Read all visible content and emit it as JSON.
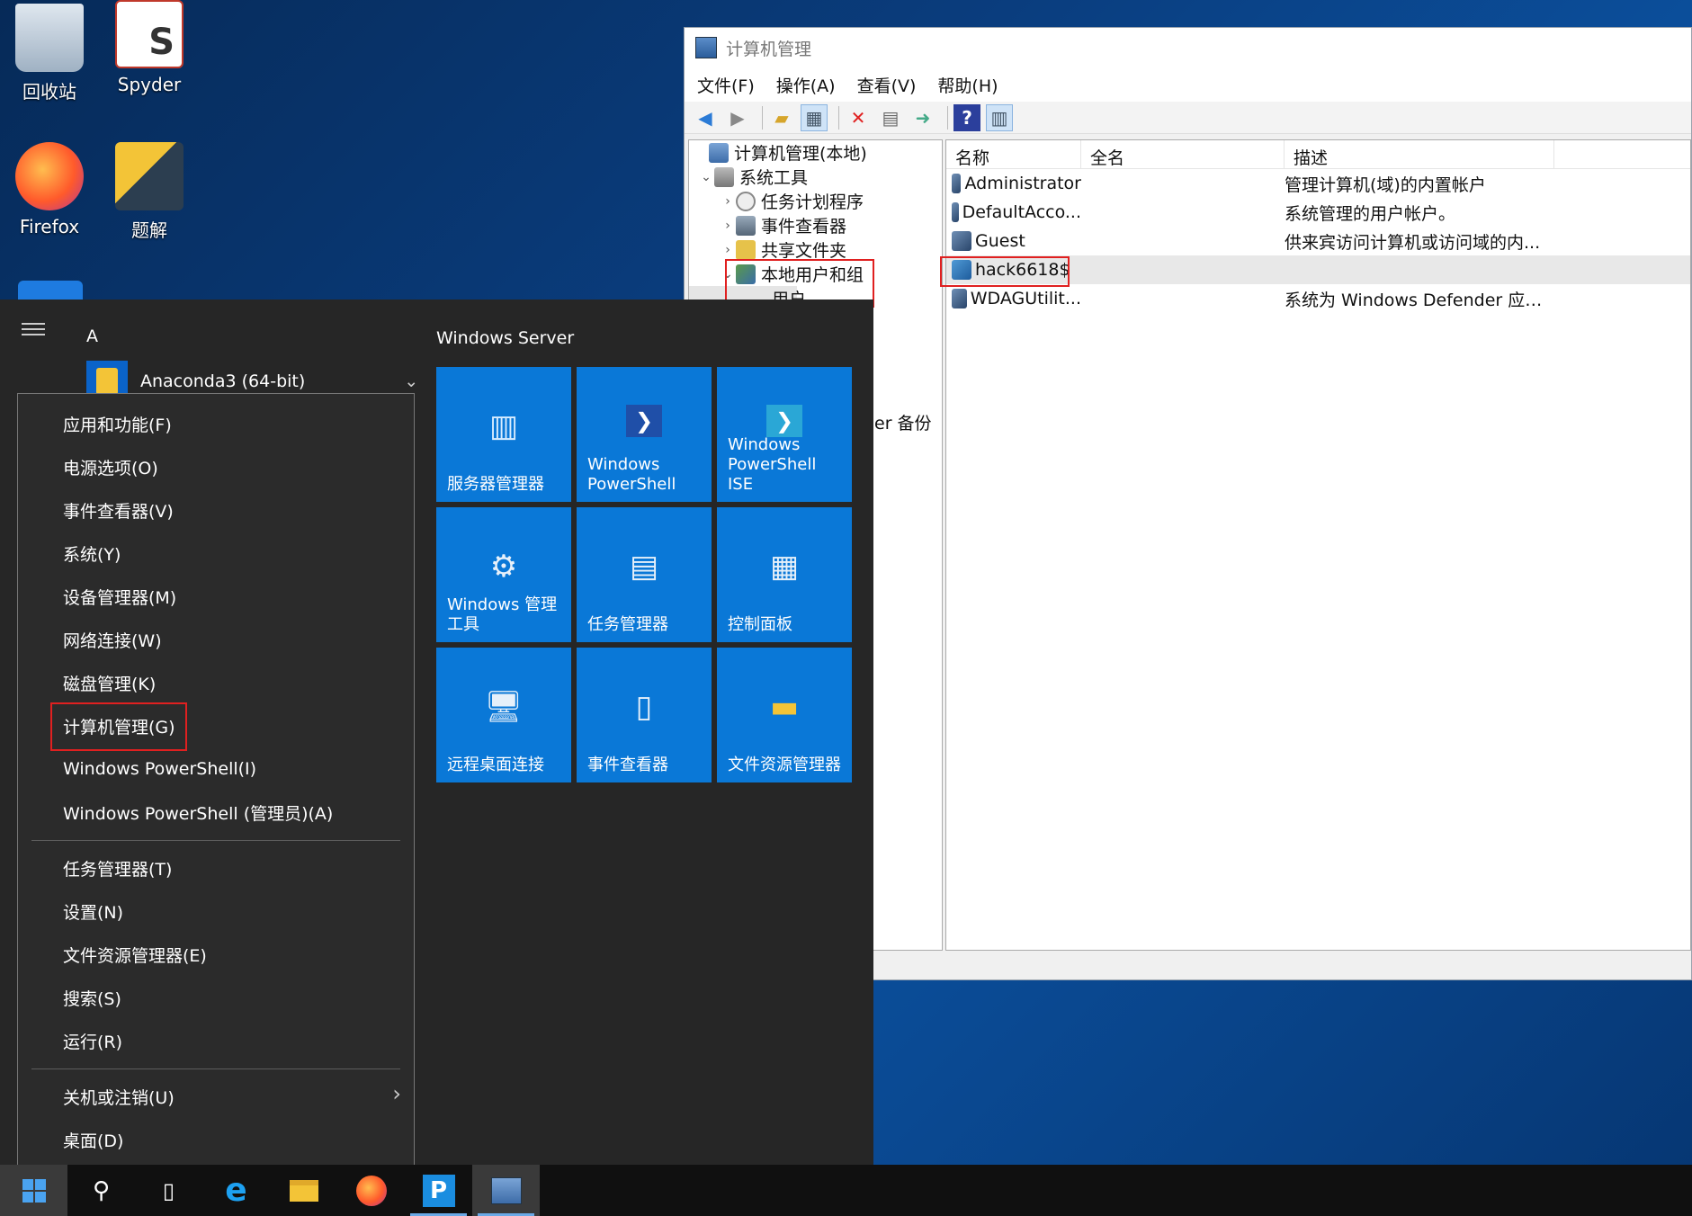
{
  "desktop": {
    "icons": [
      {
        "label": "回收站",
        "icon": "recycle-bin-icon"
      },
      {
        "label": "Spyder",
        "icon": "spyder-icon"
      },
      {
        "label": "Firefox",
        "icon": "firefox-icon"
      },
      {
        "label": "题解",
        "icon": "python-icon"
      }
    ]
  },
  "computer_management": {
    "title": "计算机管理",
    "menu": [
      "文件(F)",
      "操作(A)",
      "查看(V)",
      "帮助(H)"
    ],
    "tree": [
      {
        "label": "计算机管理(本地)",
        "level": 0,
        "arrow": ""
      },
      {
        "label": "系统工具",
        "level": 1,
        "arrow": "⌄"
      },
      {
        "label": "任务计划程序",
        "level": 2,
        "arrow": "›"
      },
      {
        "label": "事件查看器",
        "level": 2,
        "arrow": "›"
      },
      {
        "label": "共享文件夹",
        "level": 2,
        "arrow": "›"
      },
      {
        "label": "本地用户和组",
        "level": 2,
        "arrow": "⌄"
      },
      {
        "label": "用户",
        "level": 3,
        "arrow": ""
      }
    ],
    "tree_partial_text": "er 备份",
    "columns": [
      "名称",
      "全名",
      "描述"
    ],
    "users": [
      {
        "name": "Administrator",
        "full_name": "",
        "description": "管理计算机(域)的内置帐户"
      },
      {
        "name": "DefaultAcco...",
        "full_name": "",
        "description": "系统管理的用户帐户。"
      },
      {
        "name": "Guest",
        "full_name": "",
        "description": "供来宾访问计算机或访问域的内..."
      },
      {
        "name": "hack6618$",
        "full_name": "",
        "description": ""
      },
      {
        "name": "WDAGUtilit...",
        "full_name": "",
        "description": "系统为 Windows Defender 应用..."
      }
    ],
    "selected_user": "hack6618$"
  },
  "start_menu": {
    "letter": "A",
    "app": "Anaconda3 (64-bit)",
    "tiles_header": "Windows Server",
    "tiles": [
      {
        "label": "服务器管理器",
        "icon": "server-manager-icon"
      },
      {
        "label": "Windows PowerShell",
        "icon": "powershell-icon"
      },
      {
        "label": "Windows PowerShell ISE",
        "icon": "powershell-ise-icon"
      },
      {
        "label": "Windows 管理工具",
        "icon": "admin-tools-icon"
      },
      {
        "label": "任务管理器",
        "icon": "task-manager-icon"
      },
      {
        "label": "控制面板",
        "icon": "control-panel-icon"
      },
      {
        "label": "远程桌面连接",
        "icon": "remote-desktop-icon"
      },
      {
        "label": "事件查看器",
        "icon": "event-viewer-icon"
      },
      {
        "label": "文件资源管理器",
        "icon": "file-explorer-icon"
      }
    ]
  },
  "context_menu": {
    "group1": [
      "应用和功能(F)",
      "电源选项(O)",
      "事件查看器(V)",
      "系统(Y)",
      "设备管理器(M)",
      "网络连接(W)",
      "磁盘管理(K)",
      "计算机管理(G)",
      "Windows PowerShell(I)",
      "Windows PowerShell (管理员)(A)"
    ],
    "group2": [
      "任务管理器(T)",
      "设置(N)",
      "文件资源管理器(E)",
      "搜索(S)",
      "运行(R)"
    ],
    "group3": [
      "关机或注销(U)",
      "桌面(D)"
    ],
    "highlighted": "计算机管理(G)"
  },
  "taskbar": {
    "items": [
      "start-icon",
      "search-icon",
      "task-view-icon",
      "ie-icon",
      "file-explorer-icon",
      "firefox-icon",
      "pycharm-icon",
      "computer-management-icon"
    ],
    "pycharm_letter": "P"
  }
}
